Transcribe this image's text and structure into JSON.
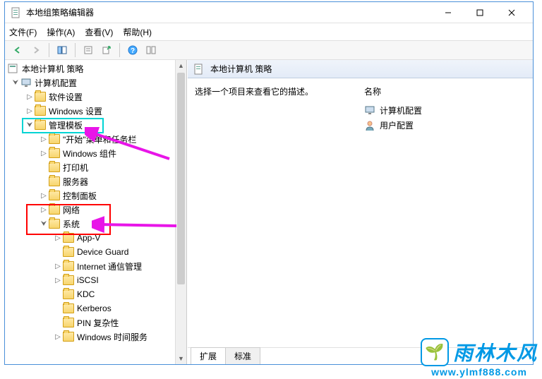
{
  "window": {
    "title": "本地组策略编辑器"
  },
  "menu": {
    "file": "文件(F)",
    "action": "操作(A)",
    "view": "查看(V)",
    "help": "帮助(H)"
  },
  "tree": {
    "root": "本地计算机 策略",
    "computer_config": "计算机配置",
    "software_settings": "软件设置",
    "windows_settings": "Windows 设置",
    "admin_templates": "管理模板",
    "start_taskbar": "\"开始\"菜单和任务栏",
    "windows_components": "Windows 组件",
    "printers": "打印机",
    "servers": "服务器",
    "control_panel": "控制面板",
    "network": "网络",
    "system": "系统",
    "appv": "App-V",
    "device_guard": "Device Guard",
    "internet_comm": "Internet 通信管理",
    "iscsi": "iSCSI",
    "kdc": "KDC",
    "kerberos": "Kerberos",
    "pin_complexity": "PIN 复杂性",
    "windows_time": "Windows 时间服务"
  },
  "right": {
    "header": "本地计算机 策略",
    "prompt": "选择一个项目来查看它的描述。",
    "col_name": "名称",
    "item_computer": "计算机配置",
    "item_user": "用户配置",
    "tab_extended": "扩展",
    "tab_standard": "标准"
  },
  "watermark": {
    "text": "雨林木风",
    "url": "www.ylmf888.com"
  }
}
